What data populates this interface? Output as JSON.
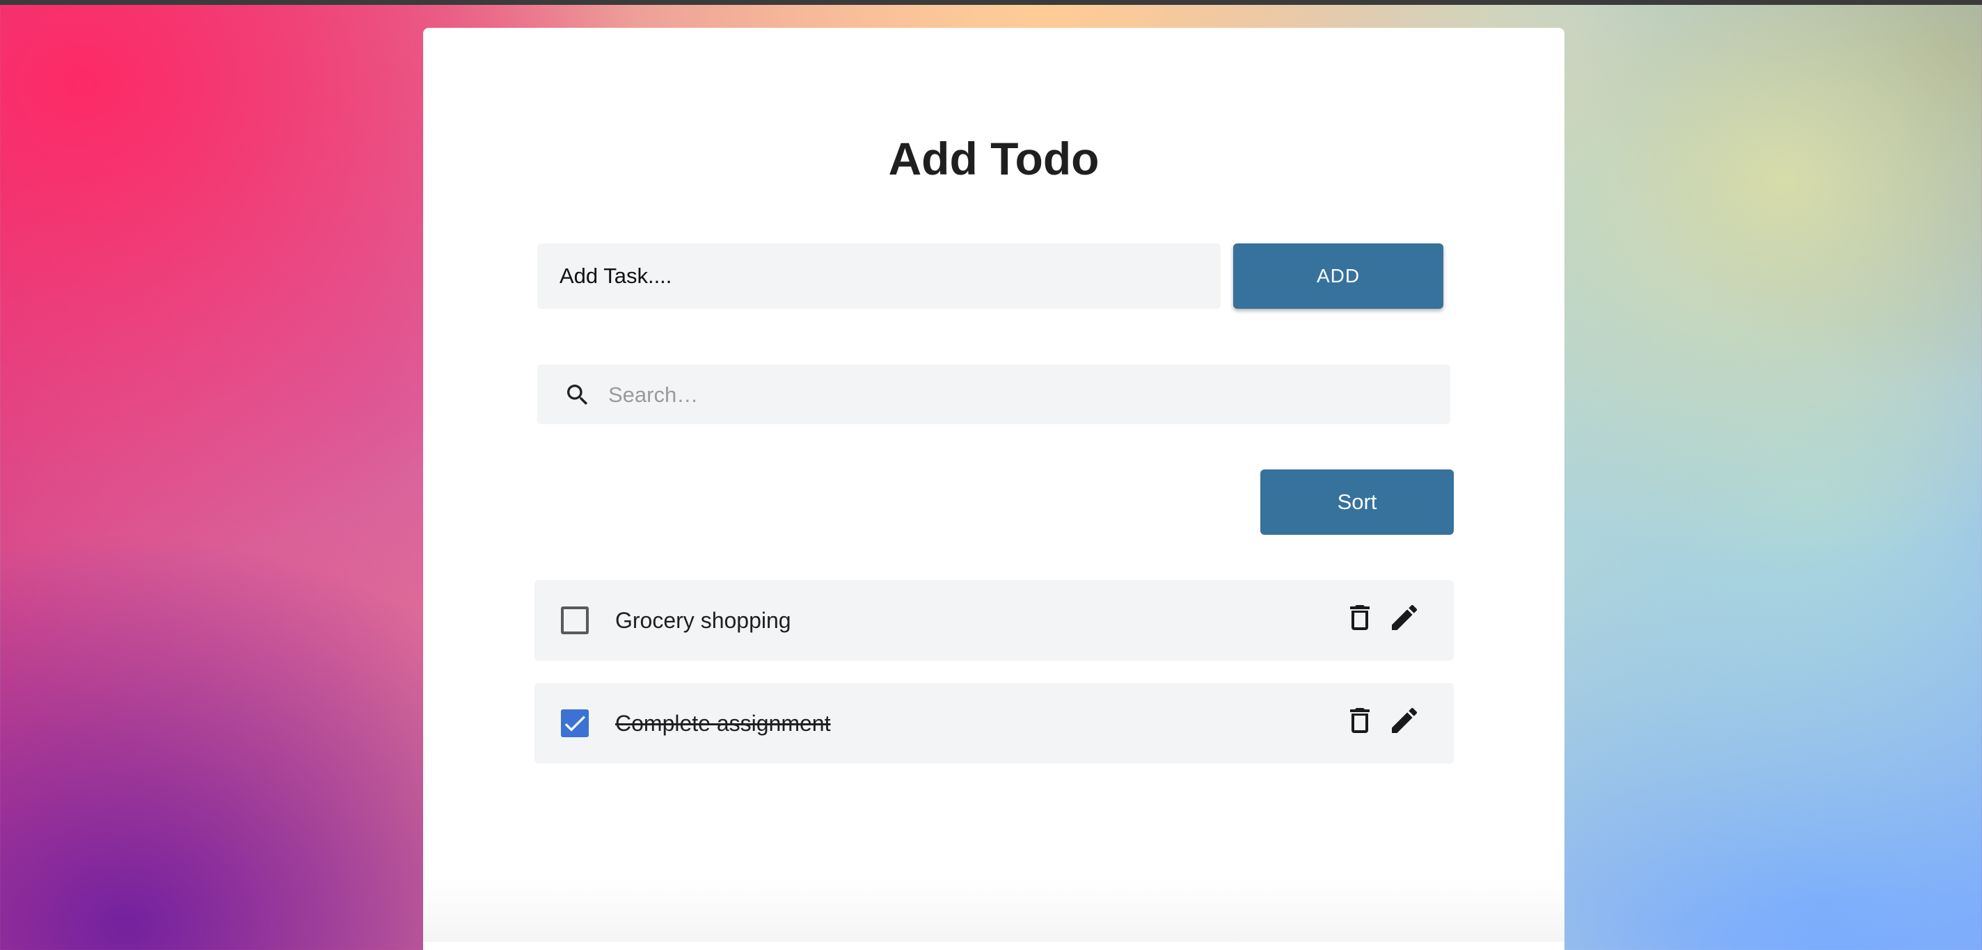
{
  "page": {
    "title": "Add Todo"
  },
  "add_form": {
    "placeholder": "Add Task....",
    "value": "",
    "button_label": "ADD"
  },
  "search": {
    "placeholder": "Search…",
    "value": "",
    "icon": "search-icon"
  },
  "sort": {
    "label": "Sort"
  },
  "todos": [
    {
      "text": "Grocery shopping",
      "completed": false,
      "delete_icon": "trash-icon",
      "edit_icon": "pencil-icon"
    },
    {
      "text": "Complete assignment",
      "completed": true,
      "delete_icon": "trash-icon",
      "edit_icon": "pencil-icon"
    }
  ],
  "colors": {
    "primary_button": "#36729c",
    "checkbox_checked": "#3b72d4",
    "row_background": "#f3f4f6",
    "card_background": "#ffffff"
  }
}
